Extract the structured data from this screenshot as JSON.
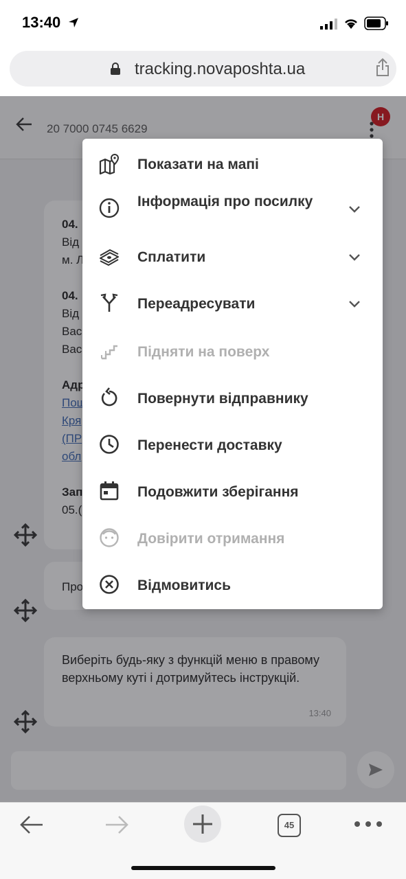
{
  "status_bar": {
    "time": "13:40"
  },
  "browser": {
    "url": "tracking.novaposhta.ua",
    "tab_count": "45"
  },
  "header": {
    "tracking_number": "20 7000 0745 6629",
    "avatar_letter": "Н"
  },
  "chat": {
    "bubble1_lines": [
      "04.",
      "Від",
      "м. Л",
      "04.",
      "Від",
      "Вас",
      "Вас",
      "Адр",
      "Пош",
      "Кря",
      "(ПР",
      "обл",
      "Зап",
      "05.("
    ],
    "bubble2_text": "Про",
    "bubble3_text": "Виберіть будь-яку з функцій меню в правому верхньому куті і дотримуйтесь інструкцій.",
    "bubble3_time": "13:40"
  },
  "menu": {
    "items": [
      {
        "label": "Показати на мапі",
        "icon": "map-icon",
        "has_chevron": false,
        "disabled": false
      },
      {
        "label": "Інформація про посилку",
        "icon": "info-icon",
        "has_chevron": true,
        "disabled": false
      },
      {
        "label": "Сплатити",
        "icon": "money-icon",
        "has_chevron": true,
        "disabled": false
      },
      {
        "label": "Переадресувати",
        "icon": "redirect-icon",
        "has_chevron": true,
        "disabled": false
      },
      {
        "label": "Підняти на поверх",
        "icon": "stairs-icon",
        "has_chevron": false,
        "disabled": true
      },
      {
        "label": "Повернути відправнику",
        "icon": "return-icon",
        "has_chevron": false,
        "disabled": false
      },
      {
        "label": "Перенести доставку",
        "icon": "clock-icon",
        "has_chevron": false,
        "disabled": false
      },
      {
        "label": "Подовжити зберігання",
        "icon": "calendar-icon",
        "has_chevron": false,
        "disabled": false
      },
      {
        "label": "Довірити отримання",
        "icon": "face-icon",
        "has_chevron": false,
        "disabled": true
      },
      {
        "label": "Відмовитись",
        "icon": "cancel-icon",
        "has_chevron": false,
        "disabled": false
      }
    ]
  },
  "colors": {
    "accent_red": "#d2161c",
    "link_blue": "#3a67b4",
    "disabled_gray": "#b0b0b0"
  }
}
